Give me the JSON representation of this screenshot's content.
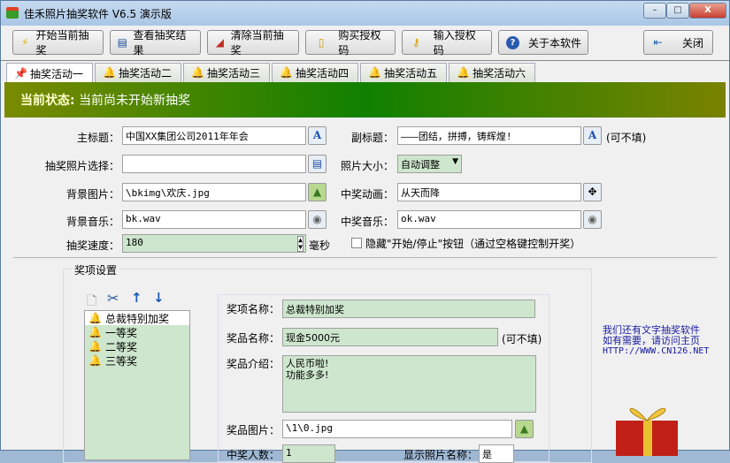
{
  "window": {
    "title": "佳禾照片抽奖软件 V6.5 演示版",
    "min": "–",
    "max": "□",
    "close": "X"
  },
  "toolbar": [
    {
      "label": "开始当前抽奖",
      "icon": "lightning-icon",
      "glyph": "⚡"
    },
    {
      "label": "查看抽奖结果",
      "icon": "list-icon",
      "glyph": "▤"
    },
    {
      "label": "清除当前抽奖",
      "icon": "eraser-icon",
      "glyph": "◢"
    },
    {
      "label": "购买授权码",
      "icon": "note-icon",
      "glyph": "▯"
    },
    {
      "label": "输入授权码",
      "icon": "key-icon",
      "glyph": "⚷"
    },
    {
      "label": "关于本软件",
      "icon": "help-icon",
      "glyph": "?"
    },
    {
      "label": "关闭",
      "icon": "exit-icon",
      "glyph": "⇤"
    }
  ],
  "tabs": [
    "抽奖活动一",
    "抽奖活动二",
    "抽奖活动三",
    "抽奖活动四",
    "抽奖活动五",
    "抽奖活动六"
  ],
  "status": {
    "label": "当前状态:",
    "text": "当前尚未开始新抽奖"
  },
  "form": {
    "main_title_label": "主标题：",
    "main_title": "中国XX集团公司2011年年会",
    "subtitle_label": "副标题：",
    "subtitle": "———团结，拼搏，铸辉煌!",
    "optional": "(可不填)",
    "photo_select_label": "抽奖照片选择：",
    "photo_select": "",
    "photo_size_label": "照片大小：",
    "photo_size": "自动调整",
    "bg_image_label": "背景图片：",
    "bg_image": "\\bkimg\\欢庆.jpg",
    "win_anim_label": "中奖动画：",
    "win_anim": "从天而降",
    "bg_music_label": "背景音乐：",
    "bg_music": "bk.wav",
    "win_music_label": "中奖音乐：",
    "win_music": "ok.wav",
    "speed_label": "抽奖速度：",
    "speed": "180",
    "speed_unit": "毫秒",
    "hide_label": "隐藏\"开始/停止\"按钮（通过空格键控制开奖）"
  },
  "prizes": {
    "group_title": "奖项设置",
    "items": [
      "总裁特别加奖",
      "一等奖",
      "二等奖",
      "三等奖"
    ],
    "name_label": "奖项名称：",
    "name": "总裁特别加奖",
    "prize_label": "奖品名称：",
    "prize": "现金5000元",
    "optional": "(可不填)",
    "intro_label": "奖品介绍：",
    "intro": "人民币啦!\n功能多多!",
    "image_label": "奖品图片：",
    "image": "\\1\\0.jpg",
    "count_label": "中奖人数：",
    "count": "1",
    "show_name_label": "显示照片名称：",
    "show_name": "是"
  },
  "promo": [
    "我们还有文字抽奖软件",
    "如有需要，请访问主页",
    "HTTP://WWW.CN126.NET"
  ]
}
